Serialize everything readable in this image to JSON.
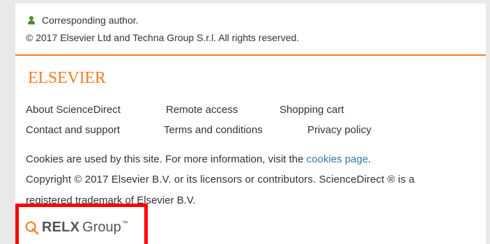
{
  "author": {
    "corresponding_label": "Corresponding author.",
    "copyright": "© 2017 Elsevier Ltd and Techna Group S.r.l. All rights reserved."
  },
  "footer": {
    "logo_text": "ELSEVIER",
    "links": {
      "about": "About ScienceDirect",
      "remote": "Remote access",
      "cart": "Shopping cart",
      "contact": "Contact and support",
      "terms": "Terms and conditions",
      "privacy": "Privacy policy"
    },
    "cookies_text": "Cookies are used by this site. For more information, visit the ",
    "cookies_link": "cookies page",
    "cookies_end": ".",
    "copyright_line1": "Copyright © 2017 Elsevier B.V. or its licensors or contributors. ScienceDirect ® is a",
    "copyright_line2": "registered trademark of Elsevier B.V.",
    "relx_word": "RELX",
    "relx_group": "Group",
    "relx_tm": "™"
  },
  "colors": {
    "accent": "#f07f24",
    "link": "#2e7aa8",
    "highlight": "#ff0000"
  }
}
